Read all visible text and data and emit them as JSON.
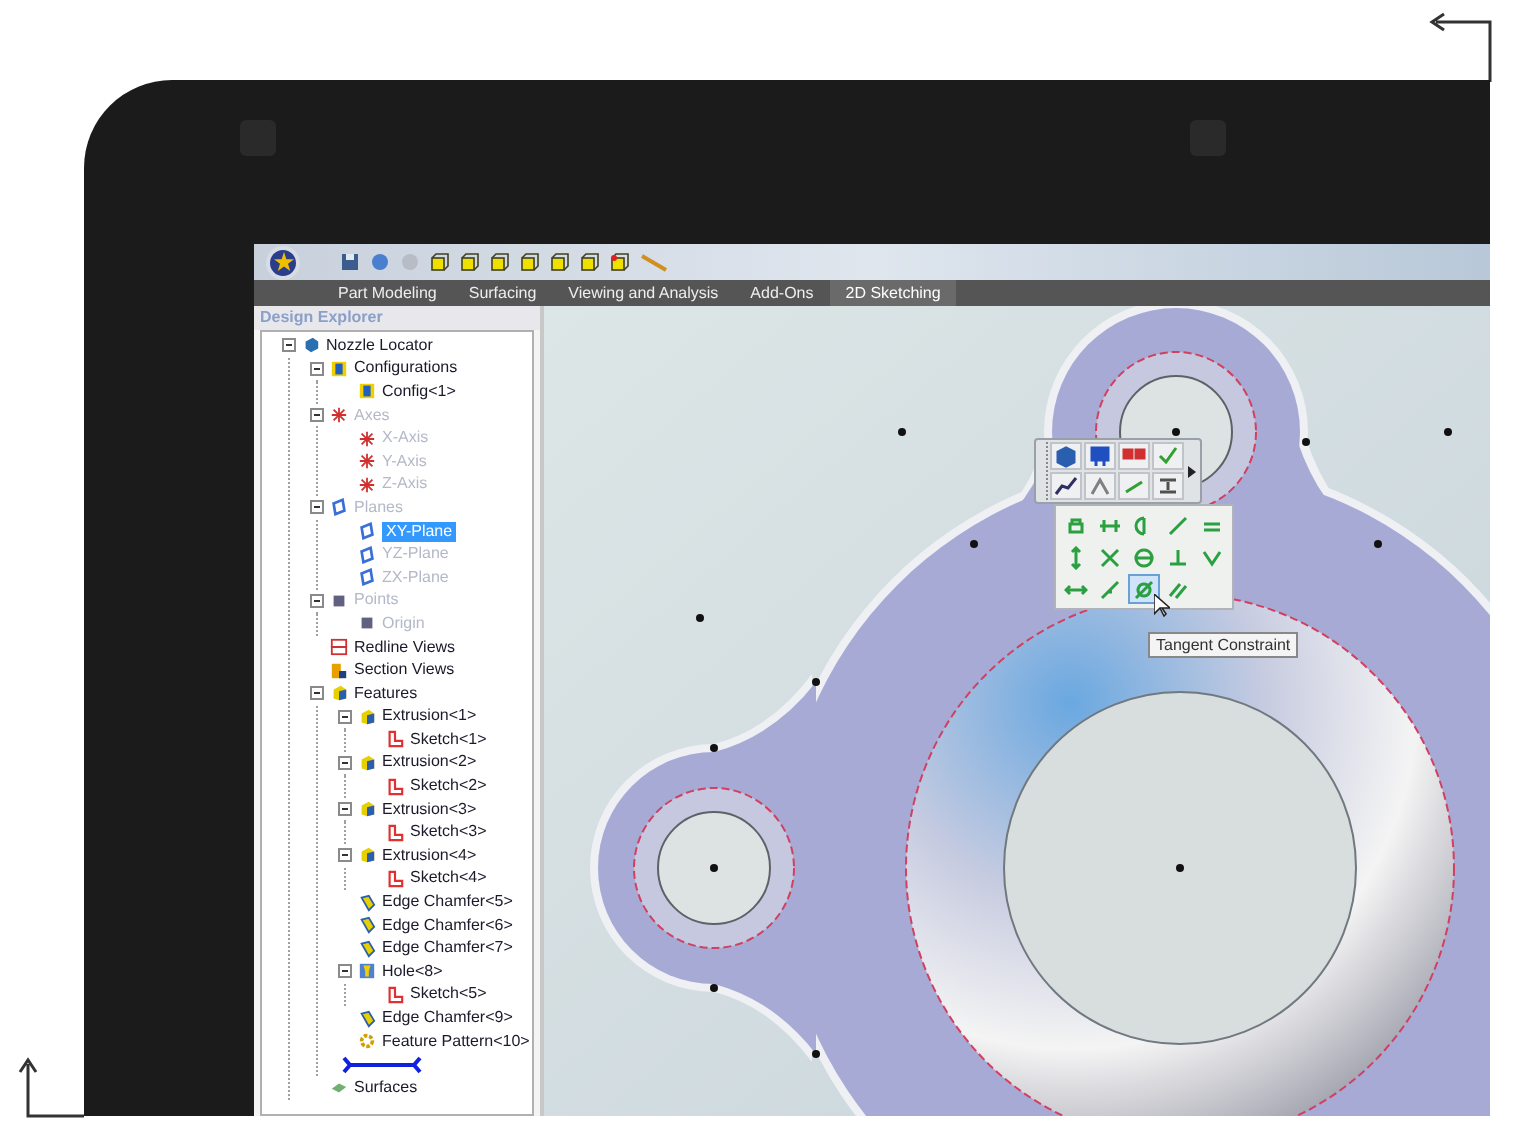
{
  "tabs": [
    {
      "label": "Part Modeling",
      "selected": false
    },
    {
      "label": "Surfacing",
      "selected": false
    },
    {
      "label": "Viewing and Analysis",
      "selected": false
    },
    {
      "label": "Add-Ons",
      "selected": false
    },
    {
      "label": "2D Sketching",
      "selected": true
    }
  ],
  "sidebar": {
    "title": "Design Explorer",
    "tree": [
      {
        "label": "Nozzle Locator",
        "kind": "part",
        "disabled": false,
        "selected": false,
        "expanded": true,
        "children": [
          {
            "label": "Configurations",
            "kind": "config",
            "disabled": false,
            "selected": false,
            "expanded": true,
            "children": [
              {
                "label": "Config<1>",
                "kind": "config",
                "disabled": false,
                "selected": false
              }
            ]
          },
          {
            "label": "Axes",
            "kind": "axis",
            "disabled": true,
            "selected": false,
            "expanded": true,
            "children": [
              {
                "label": "X-Axis",
                "kind": "axis",
                "disabled": true,
                "selected": false
              },
              {
                "label": "Y-Axis",
                "kind": "axis",
                "disabled": true,
                "selected": false
              },
              {
                "label": "Z-Axis",
                "kind": "axis",
                "disabled": true,
                "selected": false
              }
            ]
          },
          {
            "label": "Planes",
            "kind": "plane",
            "disabled": true,
            "selected": false,
            "expanded": true,
            "children": [
              {
                "label": "XY-Plane",
                "kind": "plane",
                "disabled": false,
                "selected": true
              },
              {
                "label": "YZ-Plane",
                "kind": "plane",
                "disabled": true,
                "selected": false
              },
              {
                "label": "ZX-Plane",
                "kind": "plane",
                "disabled": true,
                "selected": false
              }
            ]
          },
          {
            "label": "Points",
            "kind": "point",
            "disabled": true,
            "selected": false,
            "expanded": true,
            "children": [
              {
                "label": "Origin",
                "kind": "point",
                "disabled": true,
                "selected": false
              }
            ]
          },
          {
            "label": "Redline Views",
            "kind": "redline",
            "disabled": false,
            "selected": false
          },
          {
            "label": "Section Views",
            "kind": "section",
            "disabled": false,
            "selected": false
          },
          {
            "label": "Features",
            "kind": "extrusion",
            "disabled": false,
            "selected": false,
            "expanded": true,
            "children": [
              {
                "label": "Extrusion<1>",
                "kind": "extrusion",
                "disabled": false,
                "selected": false,
                "expanded": true,
                "children": [
                  {
                    "label": "Sketch<1>",
                    "kind": "sketch",
                    "disabled": false,
                    "selected": false
                  }
                ]
              },
              {
                "label": "Extrusion<2>",
                "kind": "extrusion",
                "disabled": false,
                "selected": false,
                "expanded": true,
                "children": [
                  {
                    "label": "Sketch<2>",
                    "kind": "sketch",
                    "disabled": false,
                    "selected": false
                  }
                ]
              },
              {
                "label": "Extrusion<3>",
                "kind": "extrusion",
                "disabled": false,
                "selected": false,
                "expanded": true,
                "children": [
                  {
                    "label": "Sketch<3>",
                    "kind": "sketch",
                    "disabled": false,
                    "selected": false
                  }
                ]
              },
              {
                "label": "Extrusion<4>",
                "kind": "extrusion",
                "disabled": false,
                "selected": false,
                "expanded": true,
                "children": [
                  {
                    "label": "Sketch<4>",
                    "kind": "sketch",
                    "disabled": false,
                    "selected": false
                  }
                ]
              },
              {
                "label": "Edge Chamfer<5>",
                "kind": "chamfer",
                "disabled": false,
                "selected": false
              },
              {
                "label": "Edge Chamfer<6>",
                "kind": "chamfer",
                "disabled": false,
                "selected": false
              },
              {
                "label": "Edge Chamfer<7>",
                "kind": "chamfer",
                "disabled": false,
                "selected": false
              },
              {
                "label": "Hole<8>",
                "kind": "hole",
                "disabled": false,
                "selected": false,
                "expanded": true,
                "children": [
                  {
                    "label": "Sketch<5>",
                    "kind": "sketch",
                    "disabled": false,
                    "selected": false
                  }
                ]
              },
              {
                "label": "Edge Chamfer<9>",
                "kind": "chamfer",
                "disabled": false,
                "selected": false
              },
              {
                "label": "Feature Pattern<10>",
                "kind": "pattern",
                "disabled": false,
                "selected": false
              },
              {
                "kind": "rollback"
              }
            ]
          },
          {
            "label": "Surfaces",
            "kind": "surface",
            "disabled": false,
            "selected": false
          }
        ]
      }
    ]
  },
  "constraints": [
    {
      "selected": false
    },
    {
      "selected": false
    },
    {
      "selected": false
    },
    {
      "selected": false
    },
    {
      "selected": false
    },
    {
      "selected": false
    },
    {
      "selected": false
    },
    {
      "selected": false
    },
    {
      "selected": false
    },
    {
      "selected": false
    },
    {
      "selected": false
    },
    {
      "selected": false
    },
    {
      "selected": true
    },
    {
      "selected": false
    }
  ],
  "tooltip": "Tangent Constraint"
}
